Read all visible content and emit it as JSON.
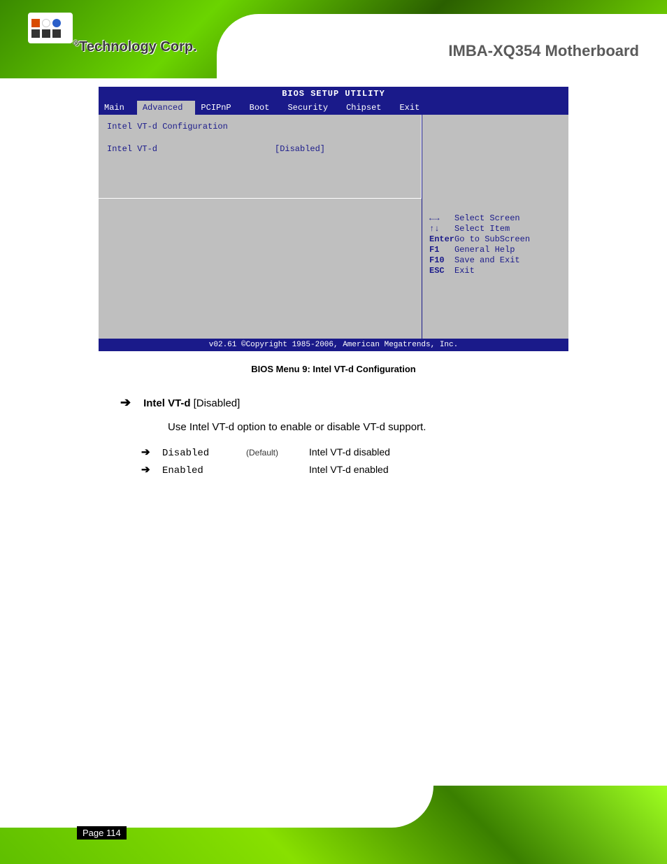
{
  "header": {
    "product": "IMBA-XQ354 Motherboard",
    "brand": "Technology Corp.",
    "brand_r": "®"
  },
  "bios": {
    "title": "BIOS SETUP UTILITY",
    "tabs": [
      "Main",
      "Advanced",
      "PCIPnP",
      "Boot",
      "Security",
      "Chipset",
      "Exit"
    ],
    "active_tab_index": 1,
    "section": "Intel VT-d Configuration",
    "setting_label": "Intel VT-d",
    "setting_value": "[Disabled]",
    "help_text": "",
    "keys": [
      {
        "sym": "←→",
        "txt": "Select Screen"
      },
      {
        "sym": "↑↓",
        "txt": "Select Item"
      },
      {
        "sym": "Enter",
        "txt": "Go to SubScreen"
      },
      {
        "sym": "F1",
        "txt": "General Help"
      },
      {
        "sym": "F10",
        "txt": "Save and Exit"
      },
      {
        "sym": "ESC",
        "txt": "Exit"
      }
    ],
    "footer": "v02.61 ©Copyright 1985-2006, American Megatrends, Inc."
  },
  "figure_caption": "BIOS Menu 9: Intel VT-d Configuration",
  "option": {
    "title": "Intel VT-d",
    "default": "[Disabled]",
    "desc": "Use Intel VT-d option to enable or disable VT-d support.",
    "values": [
      {
        "name": "Disabled",
        "def": "(Default)",
        "txt": "Intel VT-d disabled"
      },
      {
        "name": "Enabled",
        "def": "",
        "txt": "Intel VT-d enabled"
      }
    ]
  },
  "footer": {
    "page": "Page 114",
    "label": ""
  }
}
